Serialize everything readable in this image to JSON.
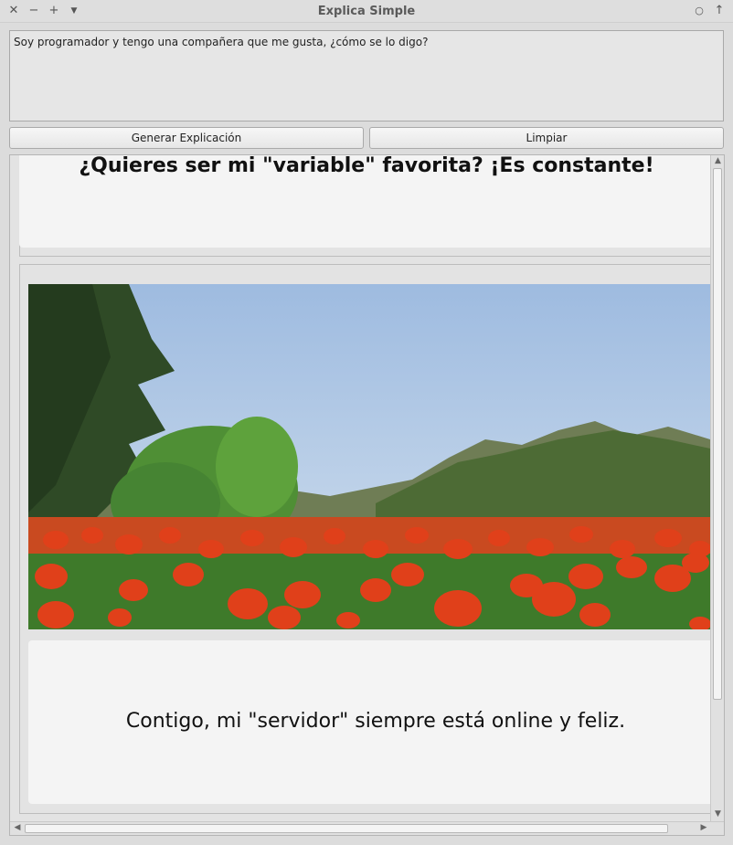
{
  "window": {
    "title": "Explica Simple",
    "icons": [
      "close-icon",
      "minimize-icon",
      "maximize-icon",
      "menu-icon",
      "circle-icon",
      "up-arrow-icon"
    ]
  },
  "input": {
    "value": "Soy programador y tengo una compañera que me gusta, ¿cómo se lo digo?"
  },
  "buttons": {
    "generate": "Generar Explicación",
    "clear": "Limpiar"
  },
  "results": {
    "card1_text": "¿Quieres ser mi \"variable\" favorita? ¡Es constante!",
    "card2_text": "Contigo, mi \"servidor\" siempre está online y feliz."
  },
  "colors": {
    "sky": "#b8d0ea",
    "tulip_red": "#e0401a",
    "foliage": "#3e7a2a"
  }
}
